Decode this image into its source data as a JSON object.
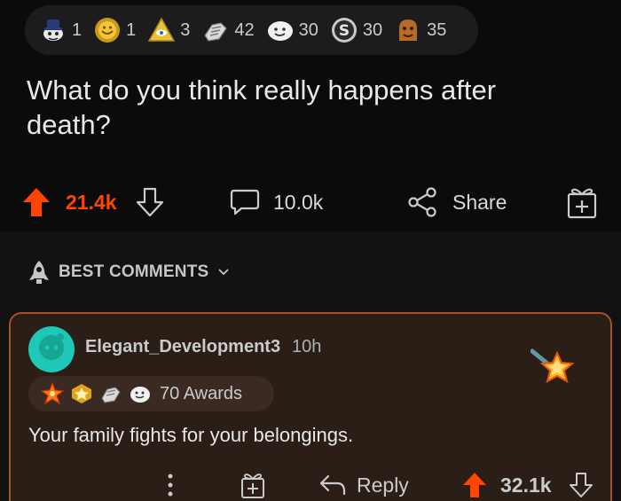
{
  "awards_bar": {
    "items": [
      {
        "icon": "tophat-award-icon",
        "count": "1"
      },
      {
        "icon": "gold-sun-award-icon",
        "count": "1"
      },
      {
        "icon": "eye-pyramid-award-icon",
        "count": "3"
      },
      {
        "icon": "helpful-hand-award-icon",
        "count": "42"
      },
      {
        "icon": "wholesome-award-icon",
        "count": "30"
      },
      {
        "icon": "silver-award-icon",
        "count": "30"
      },
      {
        "icon": "bronze-award-icon",
        "count": "35"
      }
    ]
  },
  "post": {
    "title": "What do you think really happens after death?",
    "upvotes": "21.4k",
    "comments_count": "10.0k",
    "share_label": "Share"
  },
  "comments_section": {
    "sort_label": "BEST COMMENTS"
  },
  "comment": {
    "username": "Elegant_Development3",
    "timestamp": "10h",
    "awards_total": "70 Awards",
    "body": "Your family fights for your belongings.",
    "reply_label": "Reply",
    "upvotes": "32.1k"
  },
  "colors": {
    "upvote_orange": "#ff4500",
    "card_border": "#a5512c",
    "card_background": "#2b1e17",
    "avatar_teal": "#1fc8b6"
  }
}
